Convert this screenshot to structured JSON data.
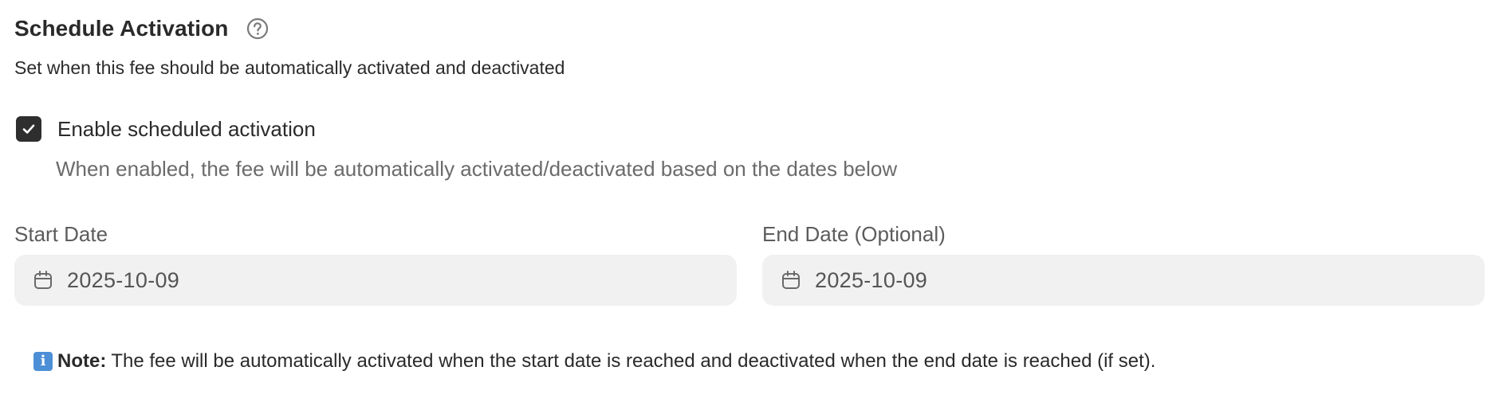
{
  "section": {
    "title": "Schedule Activation",
    "help_icon": "question-circle-icon",
    "subtitle": "Set when this fee should be automatically activated and deactivated"
  },
  "scheduled_activation": {
    "checked": true,
    "label": "Enable scheduled activation",
    "help_text": "When enabled, the fee will be automatically activated/deactivated based on the dates below"
  },
  "start_date": {
    "label": "Start Date",
    "value": "2025-10-09",
    "icon": "calendar-icon"
  },
  "end_date": {
    "label": "End Date (Optional)",
    "value": "2025-10-09",
    "icon": "calendar-icon"
  },
  "note": {
    "icon": "info-icon",
    "icon_glyph": "i",
    "label": "Note:",
    "text": "The fee will be automatically activated when the start date is reached and deactivated when the end date is reached (if set)."
  },
  "colors": {
    "checkbox_fill": "#2e2e2e",
    "input_background": "#f1f1f1",
    "info_icon": "#4c8fd6"
  }
}
